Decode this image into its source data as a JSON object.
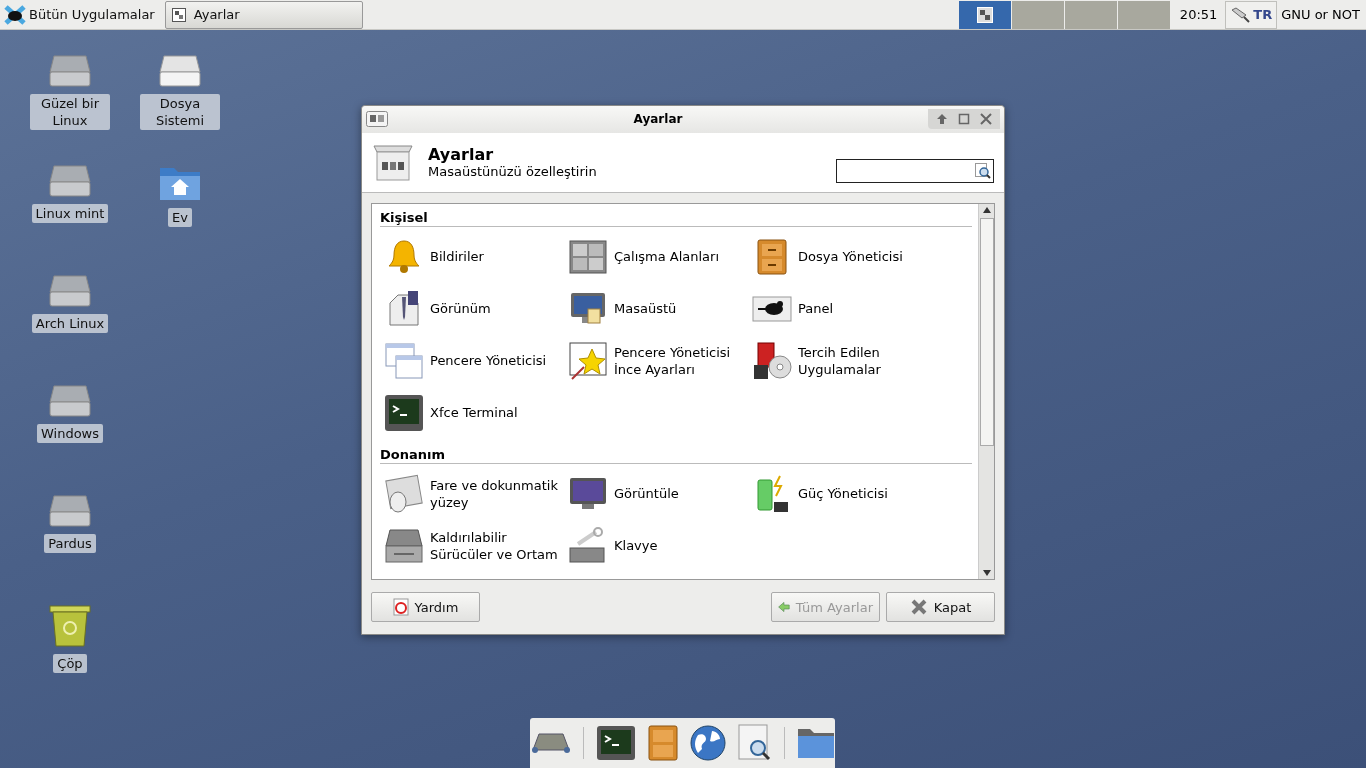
{
  "top_panel": {
    "menu_label": "Bütün Uygulamalar",
    "tasks": [
      {
        "title": "Ayarlar",
        "selected": true
      }
    ],
    "workspaces": [
      {
        "selected": true
      },
      {
        "selected": false
      },
      {
        "selected": false
      },
      {
        "selected": false
      }
    ],
    "clock": "20:51",
    "keyboard_layout": "TR",
    "user": "GNU or NOT"
  },
  "desktop_icons": [
    {
      "label": "Güzel bir Linux",
      "kind": "drive"
    },
    {
      "label": "Dosya Sistemi",
      "kind": "filesystem"
    },
    {
      "label": "Linux mint",
      "kind": "drive"
    },
    {
      "label": "Ev",
      "kind": "home"
    },
    {
      "label": "Arch Linux",
      "kind": "drive"
    },
    {
      "label": "Windows",
      "kind": "drive"
    },
    {
      "label": "Pardus",
      "kind": "drive"
    },
    {
      "label": "Çöp",
      "kind": "trash"
    }
  ],
  "window": {
    "title": "Ayarlar",
    "header_title": "Ayarlar",
    "header_subtitle": "Masaüstünüzü özelleştirin",
    "categories": [
      {
        "title": "Kişisel",
        "items": [
          {
            "label": "Bildiriler"
          },
          {
            "label": "Çalışma Alanları"
          },
          {
            "label": "Dosya Yöneticisi"
          },
          {
            "label": "Görünüm"
          },
          {
            "label": "Masaüstü"
          },
          {
            "label": "Panel"
          },
          {
            "label": "Pencere Yöneticisi"
          },
          {
            "label": "Pencere Yöneticisi İnce Ayarları"
          },
          {
            "label": "Tercih Edilen Uygulamalar"
          },
          {
            "label": "Xfce Terminal"
          }
        ]
      },
      {
        "title": "Donanım",
        "items": [
          {
            "label": "Fare ve dokunmatik yüzey"
          },
          {
            "label": "Görüntüle"
          },
          {
            "label": "Güç Yöneticisi"
          },
          {
            "label": "Kaldırılabilir Sürücüler ve Ortam"
          },
          {
            "label": "Klavye"
          }
        ]
      }
    ],
    "buttons": [
      {
        "label": "Yardım",
        "disabled": false,
        "kind": "help"
      },
      {
        "label": "Tüm Ayarlar",
        "disabled": true,
        "kind": "back"
      },
      {
        "label": "Kapat",
        "disabled": false,
        "kind": "close"
      }
    ]
  }
}
